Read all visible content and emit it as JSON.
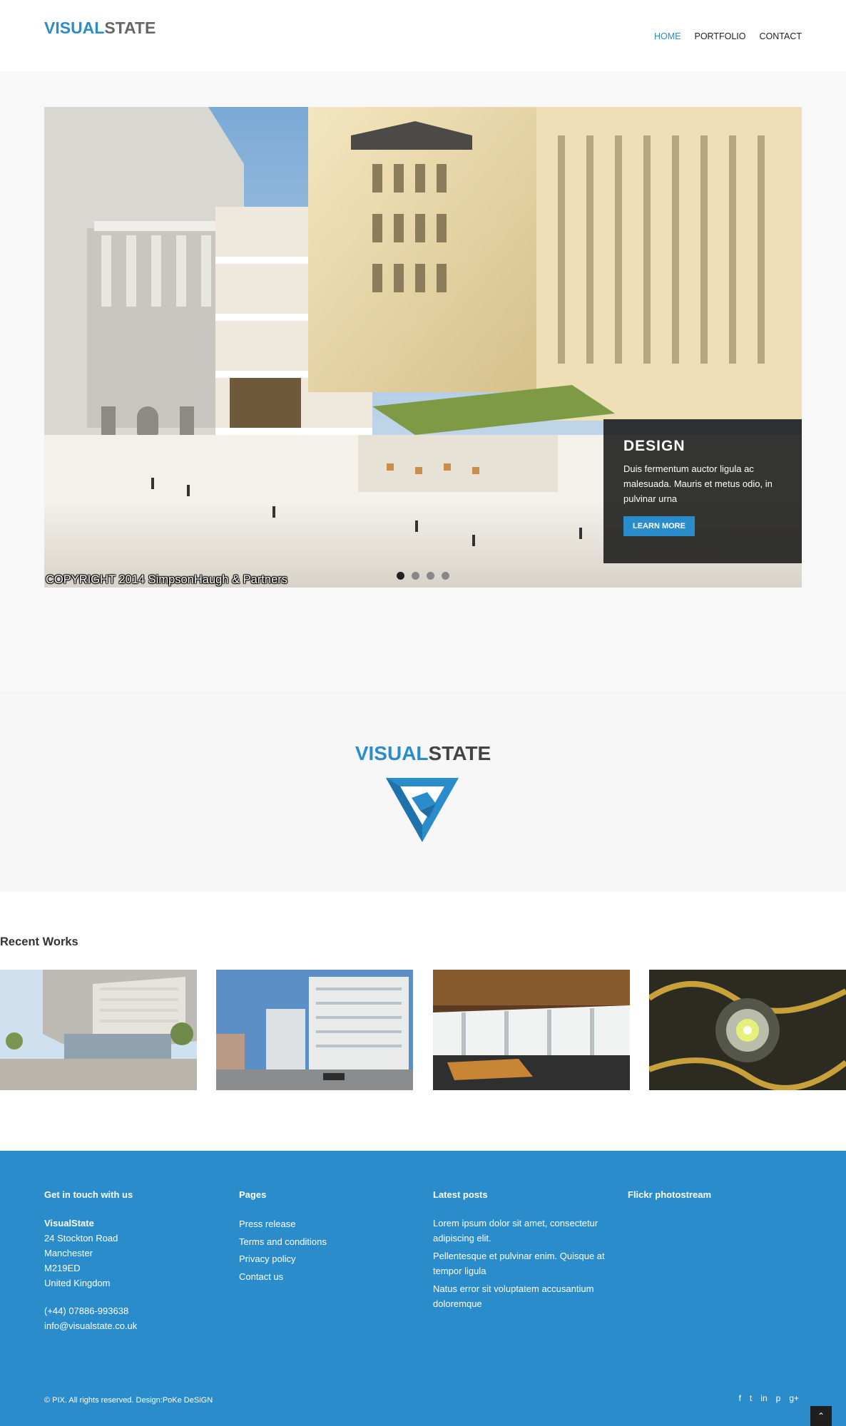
{
  "header": {
    "logo_part1": "VISUAL",
    "logo_part2": "STATE",
    "nav": [
      {
        "label": "HOME",
        "active": true
      },
      {
        "label": "PORTFOLIO",
        "active": false
      },
      {
        "label": "CONTACT",
        "active": false
      }
    ]
  },
  "slider": {
    "caption_title": "DESIGN",
    "caption_text": "Duis fermentum auctor ligula ac malesuada. Mauris et metus odio, in pulvinar urna",
    "button_label": "LEARN MORE",
    "image_credit": "COPYRIGHT 2014 SimpsonHaugh & Partners",
    "dots": 4,
    "active_dot": 0
  },
  "brand": {
    "title_part1": "VISUAL",
    "title_part2": "STATE",
    "logo_icon": "triangle-cube-logo-icon"
  },
  "works": {
    "title": "Recent Works",
    "items": [
      {
        "icon": "building-render-image"
      },
      {
        "icon": "office-blocks-image"
      },
      {
        "icon": "waterfall-image"
      },
      {
        "icon": "ornament-speaker-image"
      }
    ]
  },
  "footer": {
    "contact": {
      "heading": "Get in touch with us",
      "company": "VisualState",
      "address": [
        "24 Stockton Road",
        "Manchester",
        "M219ED",
        "United Kingdom"
      ],
      "phone": "(+44) 07886-993638",
      "email": "info@visualstate.co.uk"
    },
    "pages": {
      "heading": "Pages",
      "items": [
        "Press release",
        "Terms and conditions",
        "Privacy policy",
        "Contact us"
      ]
    },
    "posts": {
      "heading": "Latest posts",
      "items": [
        "Lorem ipsum dolor sit amet, consectetur adipiscing elit.",
        "Pellentesque et pulvinar enim. Quisque at tempor ligula",
        "Natus error sit voluptatem accusantium doloremque"
      ]
    },
    "flickr": {
      "heading": "Flickr photostream"
    },
    "copyright": "© PIX. All rights reserved. Design:PoKe DeSiGN",
    "social": [
      {
        "icon": "facebook-icon",
        "glyph": "f"
      },
      {
        "icon": "twitter-icon",
        "glyph": "t"
      },
      {
        "icon": "linkedin-icon",
        "glyph": "in"
      },
      {
        "icon": "pinterest-icon",
        "glyph": "p"
      },
      {
        "icon": "google-plus-icon",
        "glyph": "g+"
      }
    ],
    "to_top_glyph": "⌃"
  },
  "colors": {
    "brand_blue": "#2a8ccb",
    "footer_blue": "#2a8cca",
    "caption_bg": "#191919"
  }
}
